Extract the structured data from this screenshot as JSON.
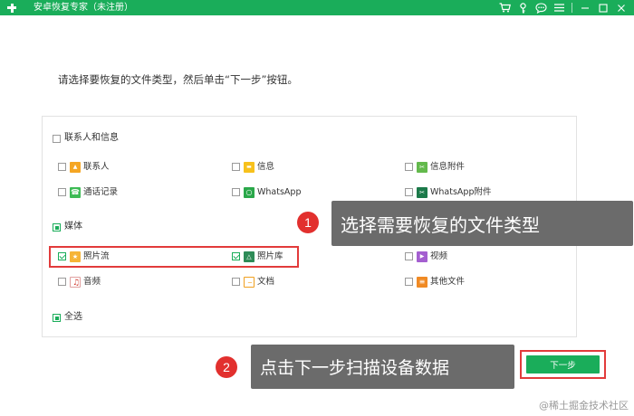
{
  "window": {
    "title": "安卓恢复专家（未注册）",
    "icons": [
      "cart-icon",
      "key-icon",
      "chat-icon",
      "menu-icon",
      "minimize-icon",
      "maximize-icon",
      "close-icon"
    ]
  },
  "instruction": "请选择要恢复的文件类型，然后单击“下一步”按钮。",
  "groups": {
    "contacts": {
      "label": "联系人和信息",
      "state": "unchecked",
      "items": [
        {
          "label": "联系人",
          "icon": "contact-icon",
          "checked": false
        },
        {
          "label": "信息",
          "icon": "message-icon",
          "checked": false
        },
        {
          "label": "信息附件",
          "icon": "attachment-icon",
          "checked": false
        },
        {
          "label": "通话记录",
          "icon": "call-log-icon",
          "checked": false
        },
        {
          "label": "WhatsApp",
          "icon": "whatsapp-icon",
          "checked": false
        },
        {
          "label": "WhatsApp附件",
          "icon": "whatsapp-attachment-icon",
          "checked": false
        }
      ]
    },
    "media": {
      "label": "媒体",
      "state": "partial",
      "items": [
        {
          "label": "照片流",
          "icon": "photo-stream-icon",
          "checked": true
        },
        {
          "label": "照片库",
          "icon": "photo-library-icon",
          "checked": true
        },
        {
          "label": "视频",
          "icon": "video-icon",
          "checked": false
        },
        {
          "label": "音频",
          "icon": "audio-icon",
          "checked": false
        },
        {
          "label": "文档",
          "icon": "document-icon",
          "checked": false
        },
        {
          "label": "其他文件",
          "icon": "other-files-icon",
          "checked": false
        }
      ]
    },
    "select_all": {
      "label": "全选",
      "state": "partial"
    }
  },
  "callouts": [
    {
      "number": "1",
      "text": "选择需要恢复的文件类型"
    },
    {
      "number": "2",
      "text": "点击下一步扫描设备数据"
    }
  ],
  "next_button": {
    "label": "下一步"
  },
  "watermark": "@稀土掘金技术社区",
  "colors": {
    "brand_green": "#1aad5a",
    "highlight_red": "#e23b3b",
    "callout_bg": "#6b6b6b",
    "badge_red": "#e2302e"
  }
}
